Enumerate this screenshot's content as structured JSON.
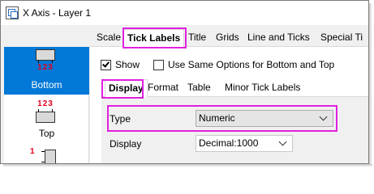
{
  "window": {
    "title": "X Axis - Layer 1"
  },
  "positions": [
    {
      "label": "Bottom",
      "nums": "123",
      "selected": true
    },
    {
      "label": "Top",
      "nums": "123",
      "selected": false
    },
    {
      "label": "",
      "nums": "1",
      "selected": false
    }
  ],
  "main_tabs": [
    "Scale",
    "Tick Labels",
    "Title",
    "Grids",
    "Line and Ticks",
    "Special Ti"
  ],
  "active_main_tab": "Tick Labels",
  "options": {
    "show_label": "Show",
    "show_checked": true,
    "same_options_label": "Use Same Options for Bottom and Top",
    "same_options_checked": false
  },
  "sub_tabs": [
    "Display",
    "Format",
    "Table",
    "Minor Tick Labels"
  ],
  "active_sub_tab": "Display",
  "fields": {
    "type_label": "Type",
    "type_value": "Numeric",
    "display_label": "Display",
    "display_value": "Decimal:1000"
  },
  "colors": {
    "highlight": "#e020e0",
    "selection": "#0078d7",
    "tick_numbers": "#e0001b"
  }
}
